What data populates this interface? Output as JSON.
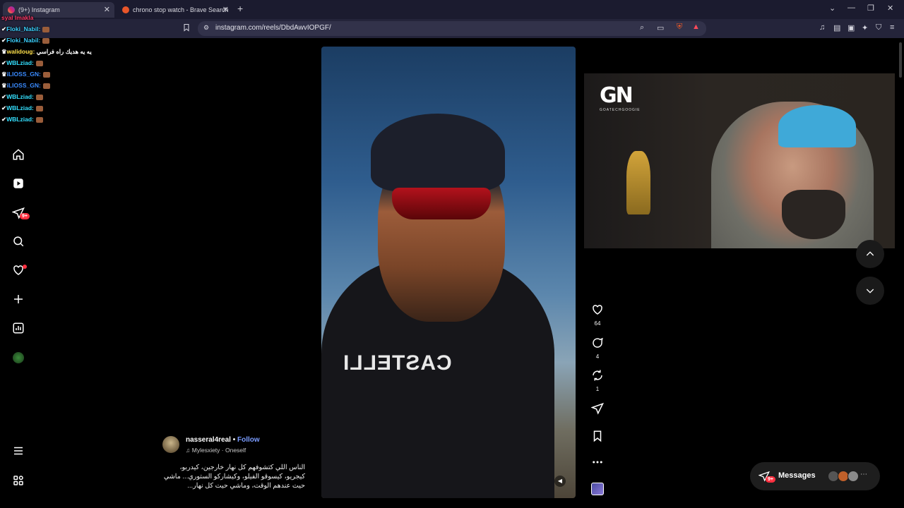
{
  "browser": {
    "tabs": [
      {
        "label": "(9+) Instagram",
        "active": true
      },
      {
        "label": "chrono stop watch - Brave Search",
        "active": false
      }
    ],
    "url": "instagram.com/reels/DbdAwvIOPGF/"
  },
  "chat": [
    {
      "user": "syal lmakla",
      "color": "#ff3b6b",
      "message": ""
    },
    {
      "user": "Floki_Nabil:",
      "color": "#3bd1ff",
      "message": ""
    },
    {
      "user": "Floki_Nabil:",
      "color": "#3bd1ff",
      "message": ""
    },
    {
      "user": "walidoug:",
      "color": "#ffe14b",
      "message": "يه يه هديك راه فراسي"
    },
    {
      "user": "WBLziad:",
      "color": "#34e0ff",
      "message": ""
    },
    {
      "user": "iLIOSS_GN:",
      "color": "#3a8bff",
      "message": ""
    },
    {
      "user": "iLIOSS_GN:",
      "color": "#3a8bff",
      "message": ""
    },
    {
      "user": "WBLziad:",
      "color": "#34e0ff",
      "message": ""
    },
    {
      "user": "WBLziad:",
      "color": "#34e0ff",
      "message": ""
    },
    {
      "user": "WBLziad:",
      "color": "#34e0ff",
      "message": ""
    }
  ],
  "sidebar": {
    "notifications_badge": "9+"
  },
  "reel": {
    "brand_text": "CASTELLI",
    "actions": {
      "likes": "64",
      "comments": "4",
      "reposts": "1"
    }
  },
  "caption": {
    "username": "nasseral4real",
    "separator": " • ",
    "follow": "Follow",
    "audio": "Mylesxiety · Oneself",
    "text": "الناس اللي كتشوفهم كل نهار خارجين، كيدربو، كيجريو، كيسوقو الفيلو، وكيشاركو الستوري... ماشي حيت عندهم الوقت، وماشي حيت كل نهار..."
  },
  "webcam": {
    "logo_text": "GN",
    "logo_sub": "GOATECHGOOGIE"
  },
  "messages": {
    "label": "Messages",
    "badge": "9+"
  }
}
